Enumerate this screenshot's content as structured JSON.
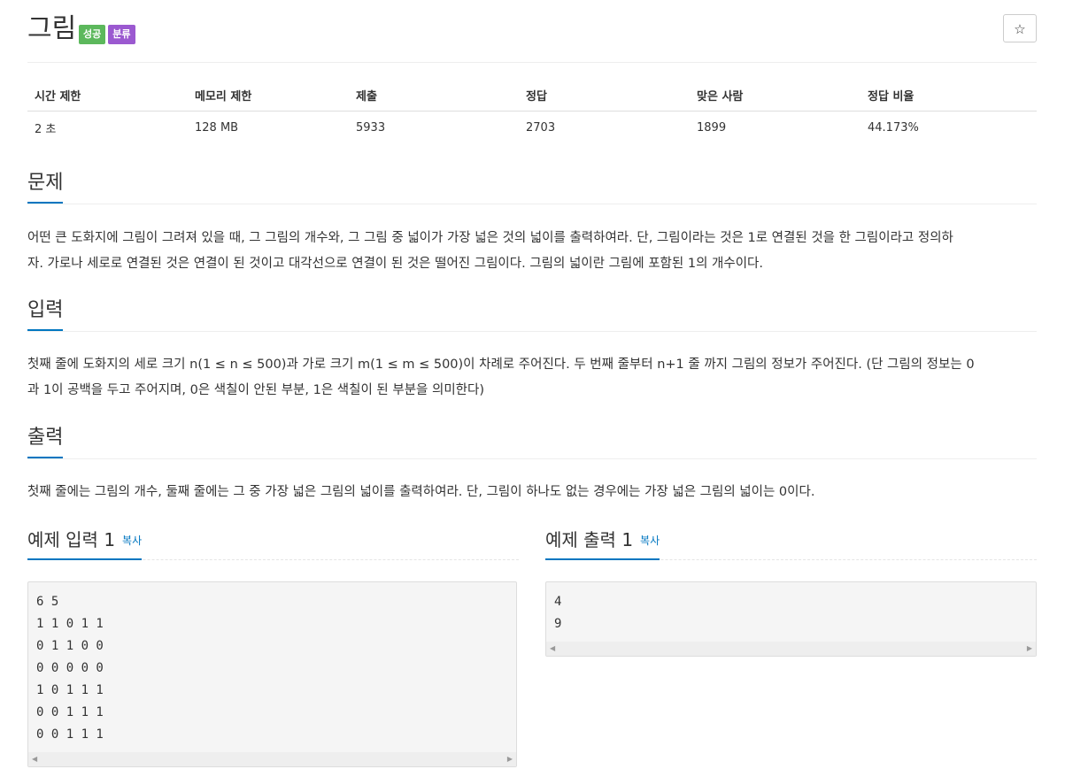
{
  "problem": {
    "title": "그림",
    "badges": [
      "성공",
      "분류"
    ],
    "star": "☆"
  },
  "info": {
    "headers": [
      "시간 제한",
      "메모리 제한",
      "제출",
      "정답",
      "맞은 사람",
      "정답 비율"
    ],
    "values": [
      "2 초",
      "128 MB",
      "5933",
      "2703",
      "1899",
      "44.173%"
    ]
  },
  "sections": {
    "problem": {
      "title": "문제",
      "line1": "어떤 큰 도화지에 그림이 그려져 있을 때, 그 그림의 개수와, 그 그림 중 넓이가 가장 넓은 것의 넓이를 출력하여라. 단, 그림이라는 것은 1로 연결된 것을 한 그림이라고 정의하",
      "line2": "자. 가로나 세로로 연결된 것은 연결이 된 것이고 대각선으로 연결이 된 것은 떨어진 그림이다. 그림의 넓이란 그림에 포함된 1의 개수이다."
    },
    "input": {
      "title": "입력",
      "line1": "첫째 줄에 도화지의 세로 크기 n(1 ≤ n ≤ 500)과 가로 크기 m(1 ≤ m ≤ 500)이 차례로 주어진다. 두 번째 줄부터 n+1 줄 까지 그림의 정보가 주어진다. (단 그림의 정보는 0",
      "line2": "과 1이 공백을 두고 주어지며, 0은 색칠이 안된 부분, 1은 색칠이 된 부분을 의미한다)"
    },
    "output": {
      "title": "출력",
      "line1": "첫째 줄에는 그림의 개수, 둘째 줄에는 그 중 가장 넓은 그림의 넓이를 출력하여라. 단, 그림이 하나도 없는 경우에는 가장 넓은 그림의 넓이는 0이다."
    }
  },
  "samples": {
    "input": {
      "title": "예제 입력 1",
      "copy": "복사",
      "lines": [
        "6 5",
        "1 1 0 1 1",
        "0 1 1 0 0",
        "0 0 0 0 0",
        "1 0 1 1 1",
        "0 0 1 1 1",
        "0 0 1 1 1"
      ]
    },
    "output": {
      "title": "예제 출력 1",
      "copy": "복사",
      "lines": [
        "4",
        "9"
      ]
    }
  },
  "colors": {
    "accent": "#0076c0",
    "success": "#5cb85c",
    "category": "#9b59d0"
  }
}
